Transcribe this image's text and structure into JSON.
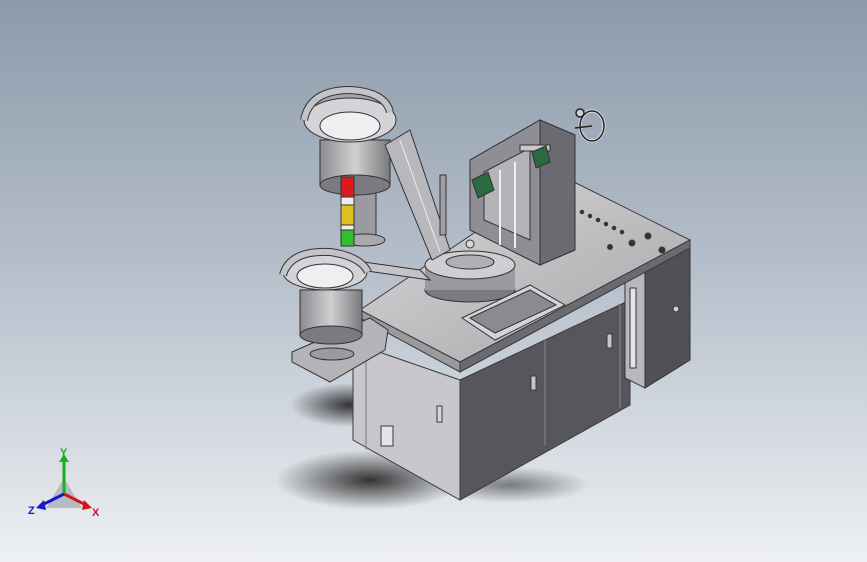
{
  "triad": {
    "x_label": "X",
    "y_label": "Y",
    "z_label": "Z",
    "x_color": "#d01818",
    "y_color": "#18b018",
    "z_color": "#1818d0"
  },
  "signal_tower": {
    "top_color": "#d81c1c",
    "middle_color": "#e0c020",
    "bottom_color": "#2ec02e"
  },
  "bearing_color": "#2a6a40"
}
